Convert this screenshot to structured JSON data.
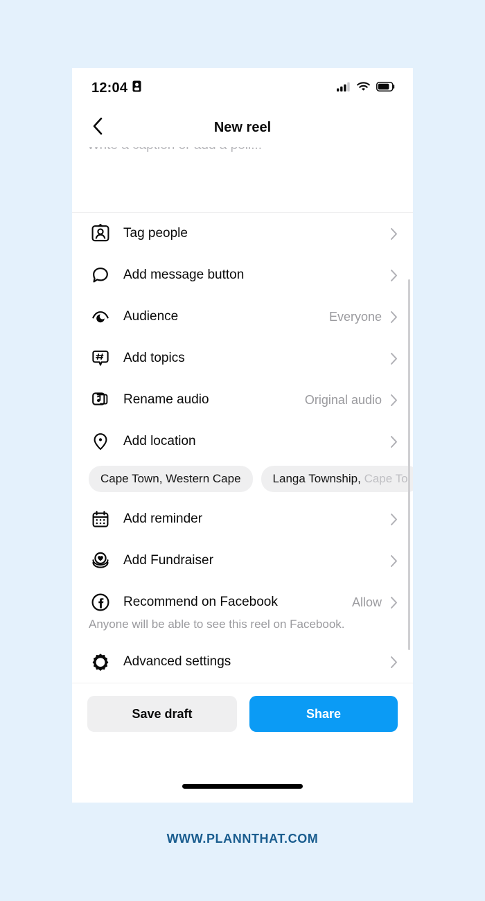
{
  "page": {
    "background_color": "#e4f1fc",
    "footer_text": "WWW.PLANNTHAT.COM",
    "footer_color": "#1a5d8f"
  },
  "status_bar": {
    "time": "12:04",
    "recording_icon": "screen-record-icon",
    "signal_icon": "cellular-signal-icon",
    "wifi_icon": "wifi-icon",
    "battery_icon": "battery-icon"
  },
  "nav": {
    "back_icon": "chevron-left-icon",
    "title": "New reel"
  },
  "caption": {
    "placeholder": "Write a caption or add a poll..."
  },
  "accent": {
    "share_blue": "#0b9bf5",
    "chip_gray": "#efeff0",
    "value_gray": "#9a9a9e"
  },
  "list": {
    "rows": [
      {
        "icon": "tag-people-icon",
        "label": "Tag people",
        "value": "",
        "chevron": "chevron-right-icon"
      },
      {
        "icon": "message-bubble-icon",
        "label": "Add message button",
        "value": "",
        "chevron": "chevron-right-icon"
      },
      {
        "icon": "audience-eye-icon",
        "label": "Audience",
        "value": "Everyone",
        "chevron": "chevron-right-icon"
      },
      {
        "icon": "hashtag-topics-icon",
        "label": "Add topics",
        "value": "",
        "chevron": "chevron-right-icon"
      },
      {
        "icon": "music-note-icon",
        "label": "Rename audio",
        "value": "Original audio",
        "chevron": "chevron-right-icon"
      },
      {
        "icon": "location-pin-icon",
        "label": "Add location",
        "value": "",
        "chevron": "chevron-right-icon"
      },
      {
        "icon": "calendar-icon",
        "label": "Add reminder",
        "value": "",
        "chevron": "chevron-right-icon"
      },
      {
        "icon": "fundraiser-heart-icon",
        "label": "Add Fundraiser",
        "value": "",
        "chevron": "chevron-right-icon"
      },
      {
        "icon": "facebook-icon",
        "label": "Recommend on Facebook",
        "value": "Allow",
        "chevron": "chevron-right-icon"
      },
      {
        "icon": "advanced-gear-icon",
        "label": "Advanced settings",
        "value": "",
        "chevron": "chevron-right-icon"
      }
    ],
    "location_chips": [
      {
        "text": "Cape Town, Western Cape"
      },
      {
        "head": "Langa Township, ",
        "tail": "Cape To"
      }
    ],
    "facebook_helper": "Anyone will be able to see this reel on Facebook."
  },
  "actions": {
    "save_draft_label": "Save draft",
    "share_label": "Share"
  }
}
